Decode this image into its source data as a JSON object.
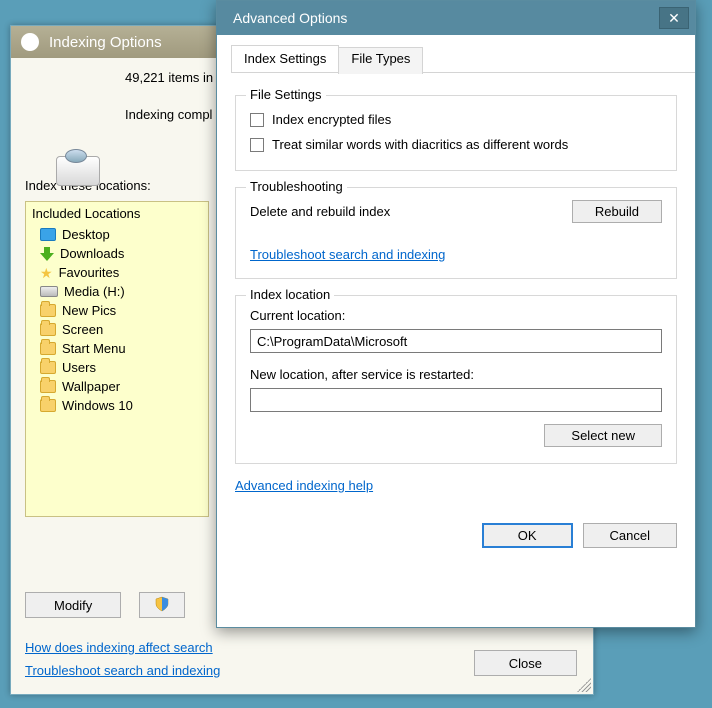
{
  "indexing": {
    "title": "Indexing Options",
    "items_line": "49,221 items in",
    "status_line": "Indexing compl",
    "locations_label": "Index these locations:",
    "included_header": "Included Locations",
    "locations": [
      {
        "icon": "desk",
        "label": "Desktop"
      },
      {
        "icon": "dl",
        "label": "Downloads"
      },
      {
        "icon": "star",
        "label": "Favourites"
      },
      {
        "icon": "media",
        "label": "Media (H:)"
      },
      {
        "icon": "folder",
        "label": "New Pics"
      },
      {
        "icon": "folder",
        "label": "Screen"
      },
      {
        "icon": "folder",
        "label": "Start Menu"
      },
      {
        "icon": "folder",
        "label": "Users"
      },
      {
        "icon": "folder",
        "label": "Wallpaper"
      },
      {
        "icon": "folder",
        "label": "Windows 10"
      }
    ],
    "modify_btn": "Modify",
    "link1": "How does indexing affect search",
    "link2": "Troubleshoot search and indexing",
    "close_btn": "Close"
  },
  "advanced": {
    "title": "Advanced Options",
    "tabs": {
      "settings": "Index Settings",
      "filetypes": "File Types"
    },
    "file_settings": {
      "legend": "File Settings",
      "chk1": "Index encrypted files",
      "chk2": "Treat similar words with diacritics as different words"
    },
    "troubleshooting": {
      "legend": "Troubleshooting",
      "delete_label": "Delete and rebuild index",
      "rebuild_btn": "Rebuild",
      "link": "Troubleshoot search and indexing"
    },
    "index_location": {
      "legend": "Index location",
      "current_label": "Current location:",
      "current_value": "C:\\ProgramData\\Microsoft",
      "new_label": "New location, after service is restarted:",
      "new_value": "",
      "select_btn": "Select new"
    },
    "help_link": "Advanced indexing help",
    "ok_btn": "OK",
    "cancel_btn": "Cancel"
  }
}
